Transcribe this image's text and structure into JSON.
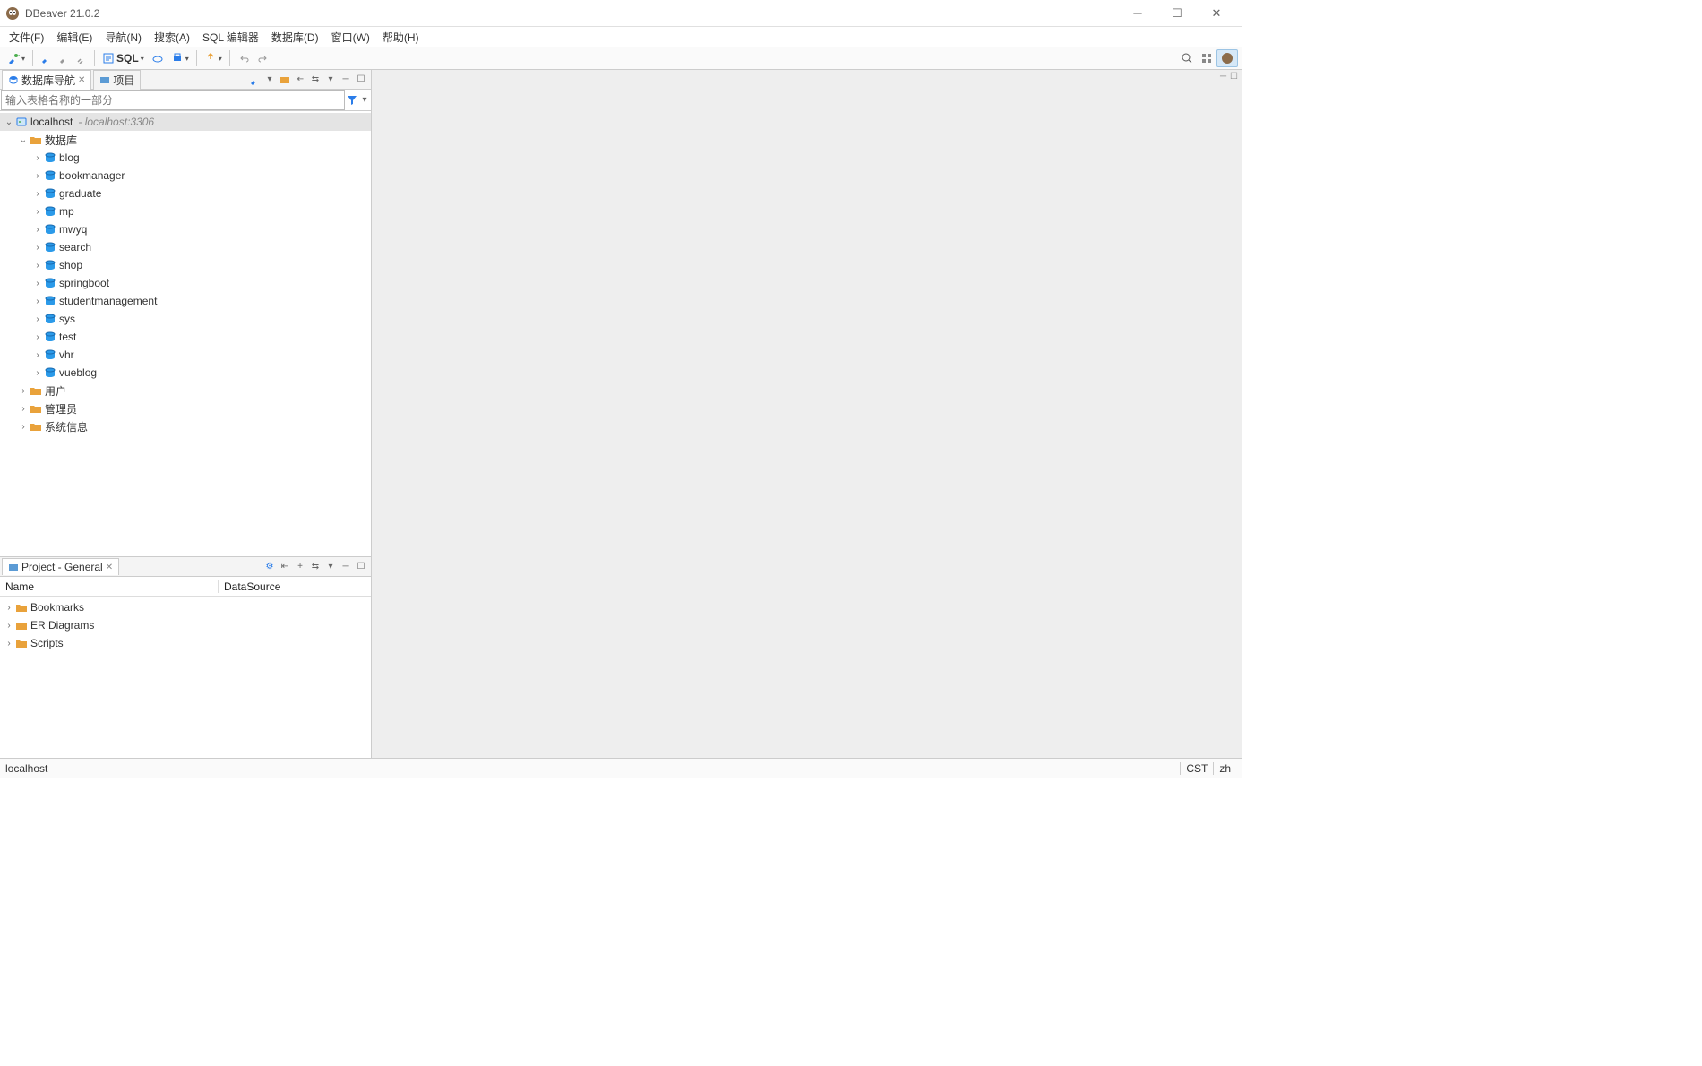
{
  "app": {
    "title": "DBeaver 21.0.2"
  },
  "menu": [
    "文件(F)",
    "编辑(E)",
    "导航(N)",
    "搜索(A)",
    "SQL 编辑器",
    "数据库(D)",
    "窗口(W)",
    "帮助(H)"
  ],
  "toolbar": {
    "sql_label": "SQL"
  },
  "nav": {
    "tab_db_navigator": "数据库导航",
    "tab_project": "项目",
    "filter_placeholder": "输入表格名称的一部分",
    "connection": {
      "name": "localhost",
      "sub": "- localhost:3306"
    },
    "db_folder": "数据库",
    "databases": [
      "blog",
      "bookmanager",
      "graduate",
      "mp",
      "mwyq",
      "search",
      "shop",
      "springboot",
      "studentmanagement",
      "sys",
      "test",
      "vhr",
      "vueblog"
    ],
    "extra_folders": [
      "用户",
      "管理员",
      "系统信息"
    ]
  },
  "project_panel": {
    "title": "Project - General",
    "col_name": "Name",
    "col_datasource": "DataSource",
    "items": [
      "Bookmarks",
      "ER Diagrams",
      "Scripts"
    ]
  },
  "status": {
    "left": "localhost",
    "tz": "CST",
    "lang": "zh"
  }
}
